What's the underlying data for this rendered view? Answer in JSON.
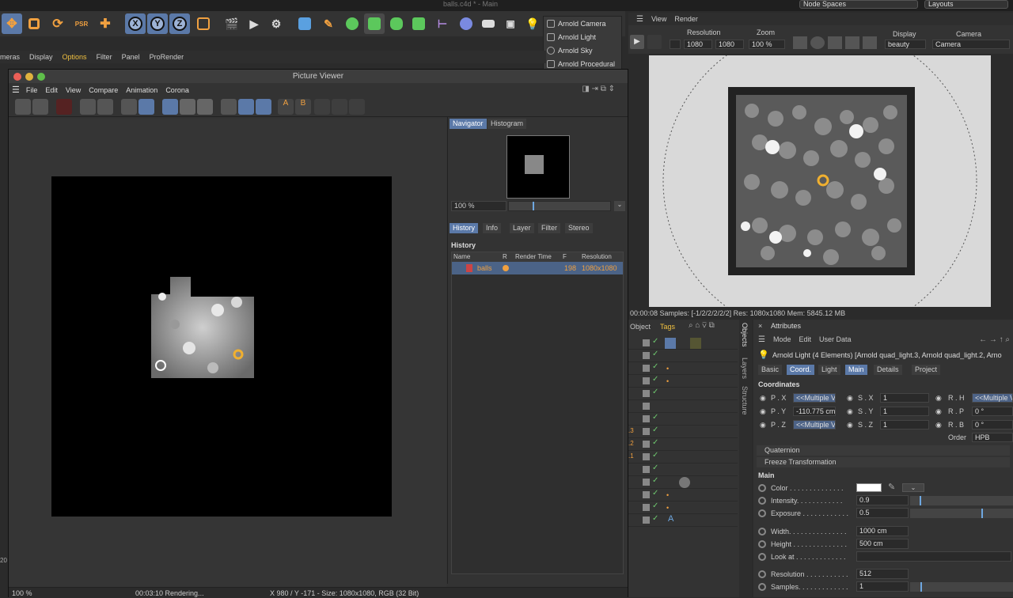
{
  "window_title": "balls.c4d * - Main",
  "top_right": {
    "node_spaces": "Node Spaces",
    "layouts": "Layouts"
  },
  "toolbar": {
    "axis_x": "X",
    "axis_y": "Y",
    "axis_z": "Z"
  },
  "arnold_menu": [
    "Arnold Camera",
    "Arnold Light",
    "Arnold Sky",
    "Arnold Procedural"
  ],
  "main_menu": [
    "meras",
    "Display",
    "Options",
    "Filter",
    "Panel",
    "ProRender"
  ],
  "picture_viewer": {
    "title": "Picture Viewer",
    "menu": [
      "File",
      "Edit",
      "View",
      "Compare",
      "Animation",
      "Corona"
    ],
    "nav_tabs": [
      "Navigator",
      "Histogram"
    ],
    "zoom": "100 %",
    "info_tabs": [
      "History",
      "Info",
      "Layer",
      "Filter",
      "Stereo"
    ],
    "history_heading": "History",
    "history_columns": [
      "Name",
      "R",
      "Render Time",
      "F",
      "Resolution"
    ],
    "history_row": {
      "name": "balls",
      "frame": "198",
      "resolution": "1080x1080"
    },
    "status": {
      "zoom": "100 %",
      "time": "00:03:10 Rendering...",
      "coords": "X 980 / Y -171 - Size: 1080x1080, RGB (32 Bit)"
    }
  },
  "render_view": {
    "menu": [
      "View",
      "Render"
    ],
    "resolution_label": "Resolution",
    "res_w": "1080",
    "res_h": "1080",
    "zoom_label": "Zoom",
    "zoom": "100 %",
    "display_label": "Display",
    "display_value": "beauty",
    "camera_label": "Camera",
    "camera_value": "Camera",
    "status": "00:00:08  Samples: [-1/2/2/2/2/2]  Res: 1080x1080  Mem: 5845.12 MB"
  },
  "objects_panel": {
    "tabs": [
      "Object",
      "Tags"
    ],
    "side_tabs": [
      "Objects",
      "Layers",
      "Structure"
    ],
    "row_suffixes": [
      ".3",
      ".2",
      ".1"
    ]
  },
  "attributes": {
    "title": "Attributes",
    "menu": [
      "Mode",
      "Edit",
      "User Data"
    ],
    "object_line": "Arnold Light (4 Elements) [Arnold quad_light.3, Arnold quad_light.2, Arno",
    "tabs": [
      "Basic",
      "Coord.",
      "Light",
      "Main",
      "Details",
      "Project"
    ],
    "coordinates_heading": "Coordinates",
    "coords": {
      "px_label": "P . X",
      "px": "<<Multiple V",
      "py_label": "P . Y",
      "py": "-110.775 cm",
      "pz_label": "P . Z",
      "pz": "<<Multiple V",
      "sx_label": "S . X",
      "sx": "1",
      "sy_label": "S . Y",
      "sy": "1",
      "sz_label": "S . Z",
      "sz": "1",
      "rh_label": "R . H",
      "rh": "<<Multiple V",
      "rp_label": "R . P",
      "rp": "0 °",
      "rb_label": "R . B",
      "rb": "0 °",
      "order_label": "Order",
      "order": "HPB"
    },
    "quaternion": "Quaternion",
    "freeze": "Freeze Transformation",
    "main_heading": "Main",
    "params": [
      {
        "label": "Color . . . . . . . . . . . . . .",
        "value": ""
      },
      {
        "label": "Intensity. . . . . . . . . . . .",
        "value": "0.9",
        "level": 0.09
      },
      {
        "label": "Exposure . . . . . . . . . . . .",
        "value": "0.5",
        "level": 0.7
      },
      {
        "label": "Width. . . . . . . . . . . . . . .",
        "value": "1000 cm"
      },
      {
        "label": "Height . . . . . . . . . . . . . .",
        "value": "500 cm"
      },
      {
        "label": "Look at . . . . . . . . . . . . .",
        "value": ""
      },
      {
        "label": "Resolution . . . . . . . . . . .",
        "value": "512"
      },
      {
        "label": "Samples. . . . . . . . . . . . .",
        "value": "1",
        "level": 0.1
      }
    ]
  },
  "left_edge_number": "20",
  "colors": {
    "accent": "#5b79a8",
    "orange": "#f0a040",
    "green": "#6ec66e"
  }
}
